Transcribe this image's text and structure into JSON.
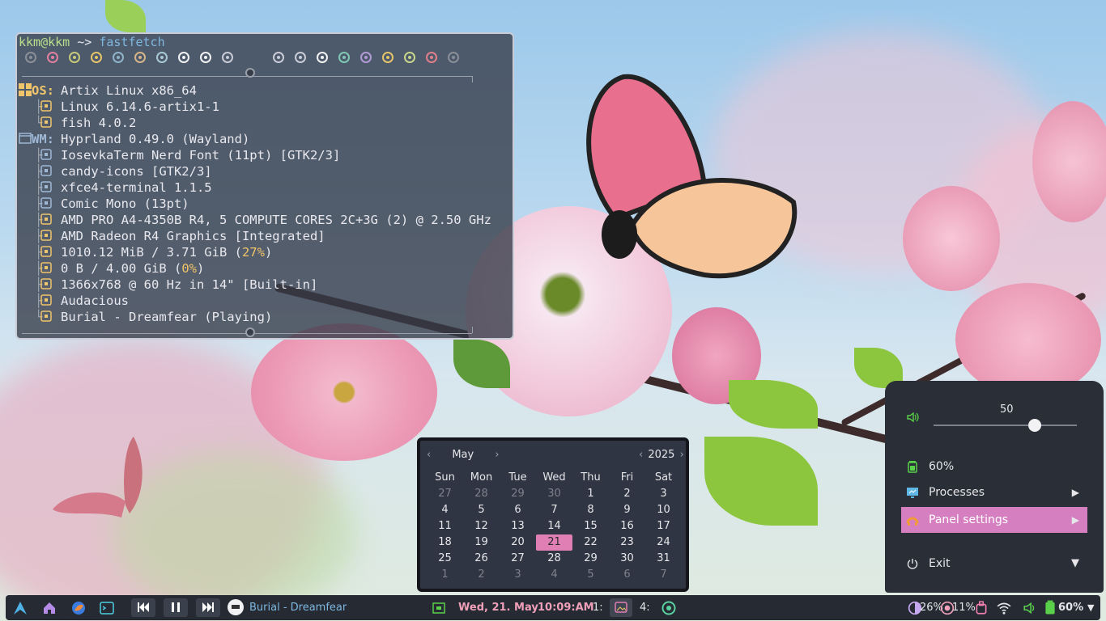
{
  "terminal": {
    "prompt_user": "kkm@kkm",
    "prompt_sep": " ~> ",
    "command": "fastfetch",
    "os_label": "OS:",
    "wm_label": "WM:",
    "rows": [
      {
        "text": "Artix Linux x86_64"
      },
      {
        "text": "Linux 6.14.6-artix1-1"
      },
      {
        "text": "fish 4.0.2"
      },
      {
        "text": "Hyprland 0.49.0 (Wayland)"
      },
      {
        "text": "IosevkaTerm Nerd Font (11pt) [GTK2/3]"
      },
      {
        "text": "candy-icons [GTK2/3]"
      },
      {
        "text": "xfce4-terminal 1.1.5"
      },
      {
        "text": "Comic Mono (13pt)"
      },
      {
        "text": "AMD PRO A4-4350B R4, 5 COMPUTE CORES 2C+3G (2) @ 2.50 GHz"
      },
      {
        "text": "AMD Radeon R4 Graphics [Integrated]"
      },
      {
        "text": "1010.12 MiB / 3.71 GiB (",
        "pct": "27%",
        "tail": ")"
      },
      {
        "text": "0 B / 4.00 GiB (",
        "pct": "0%",
        "tail": ")"
      },
      {
        "text": "1366x768 @ 60 Hz in 14\" [Built-in]"
      },
      {
        "text": "Audacious"
      },
      {
        "text": "Burial - Dreamfear (Playing)"
      }
    ],
    "palette": [
      "#8a8f98",
      "#e07fa0",
      "#c9c97a",
      "#e6c46a",
      "#8fb3c9",
      "#d6b48a",
      "#a9c9d6",
      "#f2f2f4",
      "#f2f2f4",
      "#c9ccd6",
      "#c9ccd6",
      "#c9ccd6",
      "#f2f2f4",
      "#7fc9b3",
      "#b39ad6",
      "#e6c46a",
      "#c9d68a",
      "#e07f8a",
      "#8a8f98"
    ]
  },
  "calendar": {
    "month": "May",
    "year": "2025",
    "weekdays": [
      "Sun",
      "Mon",
      "Tue",
      "Wed",
      "Thu",
      "Fri",
      "Sat"
    ],
    "weeks": [
      [
        "27",
        "28",
        "29",
        "30",
        "1",
        "2",
        "3"
      ],
      [
        "4",
        "5",
        "6",
        "7",
        "8",
        "9",
        "10"
      ],
      [
        "11",
        "12",
        "13",
        "14",
        "15",
        "16",
        "17"
      ],
      [
        "18",
        "19",
        "20",
        "21",
        "22",
        "23",
        "24"
      ],
      [
        "25",
        "26",
        "27",
        "28",
        "29",
        "30",
        "31"
      ],
      [
        "1",
        "2",
        "3",
        "4",
        "5",
        "6",
        "7"
      ]
    ],
    "today": "21"
  },
  "panel": {
    "volume": "50",
    "volume_level": 0.5,
    "battery": "60%",
    "items": [
      {
        "label": "Processes"
      },
      {
        "label": "Panel settings"
      },
      {
        "label": "Exit"
      }
    ]
  },
  "taskbar": {
    "now_playing": "Burial - Dreamfear",
    "date": "Wed, 21. May",
    "time": "10:09:AM",
    "ws1": "1:",
    "ws4": "4:",
    "cpu": "26%",
    "mem": "11%",
    "battery": "60%"
  },
  "colors": {
    "accent": "#d67fc0",
    "date_text": "#f0a0b8",
    "now_playing": "#7fb7e0",
    "battery_green": "#5ad04a"
  }
}
